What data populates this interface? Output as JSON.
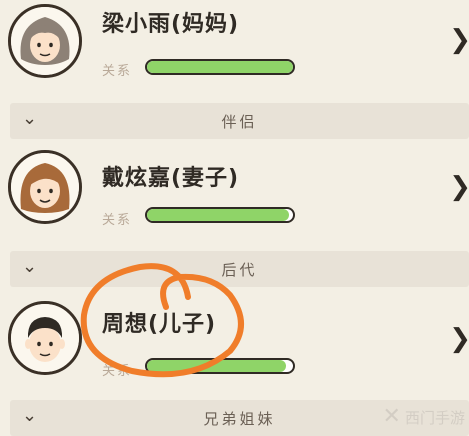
{
  "members": [
    {
      "name": "梁小雨(妈妈)",
      "relation_label": "关系",
      "relation_level": 1.0,
      "avatar": "old-woman-avatar"
    },
    {
      "name": "戴炫嘉(妻子)",
      "relation_label": "关系",
      "relation_level": 0.97,
      "avatar": "woman-avatar"
    },
    {
      "name": "周想(儿子)",
      "relation_label": "关系",
      "relation_level": 0.95,
      "avatar": "boy-avatar"
    }
  ],
  "sections": {
    "partner": "伴侣",
    "offspring": "后代",
    "siblings": "兄弟姐妹"
  },
  "watermark": "西门手游",
  "colors": {
    "background": "#f3efe4",
    "bar_fill": "#8fd468",
    "annotation": "#f07d2a",
    "section_bg": "#e8e2d7"
  }
}
